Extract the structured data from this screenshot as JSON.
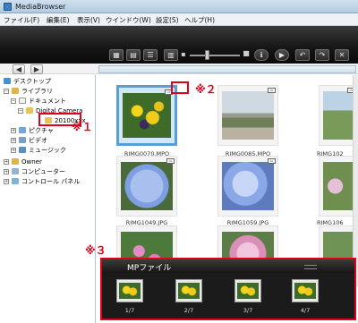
{
  "window": {
    "title": "MediaBrowser"
  },
  "menu": [
    "ファイル(F)",
    "編集(E)",
    "表示(V)",
    "ウインドウ(W)",
    "設定(S)",
    "ヘルプ(H)"
  ],
  "tree": [
    {
      "label": "デスクトップ",
      "icon": "desktop-icon",
      "level": 0,
      "expander": ""
    },
    {
      "label": "ライブラリ",
      "icon": "library-icon",
      "level": 1,
      "expander": "−"
    },
    {
      "label": "ドキュメント",
      "icon": "document-icon",
      "level": 2,
      "expander": "−"
    },
    {
      "label": "Digital Camera",
      "icon": "folder-icon",
      "level": 3,
      "expander": "−"
    },
    {
      "label": "20100xxx",
      "icon": "folder-icon",
      "level": 4,
      "expander": ""
    },
    {
      "label": "ピクチャ",
      "icon": "picture-icon",
      "level": 2,
      "expander": "+"
    },
    {
      "label": "ビデオ",
      "icon": "video-icon",
      "level": 2,
      "expander": "+"
    },
    {
      "label": "ミュージック",
      "icon": "music-icon",
      "level": 2,
      "expander": "+"
    },
    {
      "label": "Owner",
      "icon": "user-icon",
      "level": 1,
      "expander": "+"
    },
    {
      "label": "コンピューター",
      "icon": "computer-icon",
      "level": 1,
      "expander": "+"
    },
    {
      "label": "コントロール パネル",
      "icon": "control-panel-icon",
      "level": 1,
      "expander": "+"
    }
  ],
  "thumbnails": [
    {
      "name": "RIMG0070.MPO",
      "scene": "flowers-yellow",
      "mp": true,
      "selected": true
    },
    {
      "name": "RIMG0085.MPO",
      "scene": "bridge",
      "mp": true,
      "selected": false
    },
    {
      "name": "RIMG102",
      "scene": "landscape",
      "mp": true,
      "selected": false
    },
    {
      "name": "RIMG1049.JPG",
      "scene": "hydrangea-blue",
      "mp": false,
      "selected": false
    },
    {
      "name": "RIMG1059.JPG",
      "scene": "hydrangea-blue",
      "mp": false,
      "selected": false
    },
    {
      "name": "RIMG106",
      "scene": "leaves-pink",
      "mp": false,
      "selected": false
    },
    {
      "name": "",
      "scene": "flowers-pink",
      "mp": false,
      "selected": false
    },
    {
      "name": "",
      "scene": "flowers-pink",
      "mp": false,
      "selected": false
    },
    {
      "name": "",
      "scene": "leaves",
      "mp": false,
      "selected": false
    }
  ],
  "annotations": {
    "note1": "※１",
    "note2": "※２",
    "note3": "※３"
  },
  "mp_panel": {
    "title": "MPファイル",
    "frames": [
      "1/7",
      "2/7",
      "3/7",
      "4/7"
    ]
  },
  "colors": {
    "accent_red": "#e0001b",
    "selection_blue": "#5a9fd4"
  }
}
